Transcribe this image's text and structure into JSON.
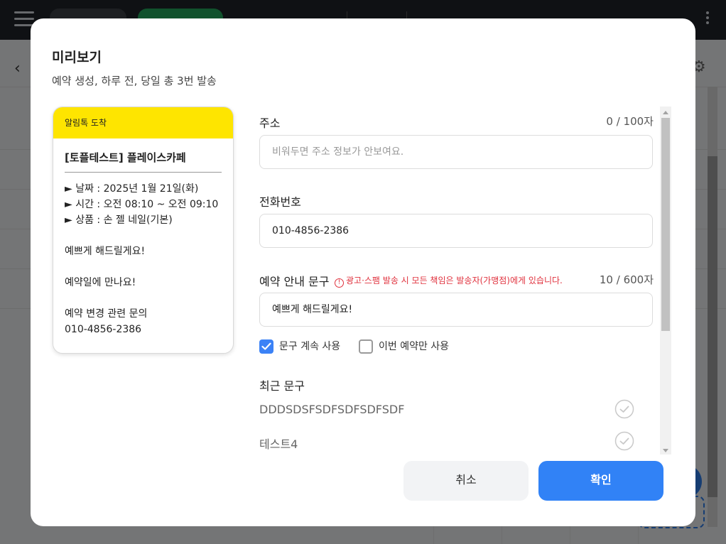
{
  "modal": {
    "title": "미리보기",
    "subtitle": "예약 생성, 하루 전, 당일 총 3번 발송"
  },
  "preview_card": {
    "header": "알림톡 도착",
    "title": "[토플테스트] 플레이스카페",
    "lines": [
      "► 날짜 : 2025년 1월 21일(화)",
      "► 시간 : 오전 08:10 ~ 오전 09:10",
      "► 상품 : 손 젤 네일(기본)"
    ],
    "message": "예쁘게 해드릴게요!",
    "closing": "예약일에 만나요!",
    "inquiry_label": "예약 변경 관련 문의",
    "inquiry_phone": "010-4856-2386"
  },
  "form": {
    "address": {
      "label": "주소",
      "count": "0 / 100자",
      "placeholder": "비워두면 주소 정보가 안보여요.",
      "value": ""
    },
    "phone": {
      "label": "전화번호",
      "value": "010-4856-2386"
    },
    "notice": {
      "label": "예약 안내 문구",
      "warning": "광고·스팸 발송 시 모든 책임은 발송자(가맹점)에게 있습니다.",
      "count": "10 / 600자",
      "value": "예쁘게 해드릴게요!"
    },
    "options": {
      "keep_label": "문구 계속 사용",
      "keep_checked": true,
      "once_label": "이번 예약만 사용",
      "once_checked": false
    },
    "recent": {
      "label": "최근 문구",
      "items": [
        "DDDSDSFSDFSDFSDFSDF",
        "테스트4"
      ]
    }
  },
  "buttons": {
    "cancel": "취소",
    "confirm": "확인"
  },
  "colors": {
    "kakao_yellow": "#fee500",
    "primary_blue": "#3182f6",
    "warning_red": "#e0313d"
  }
}
